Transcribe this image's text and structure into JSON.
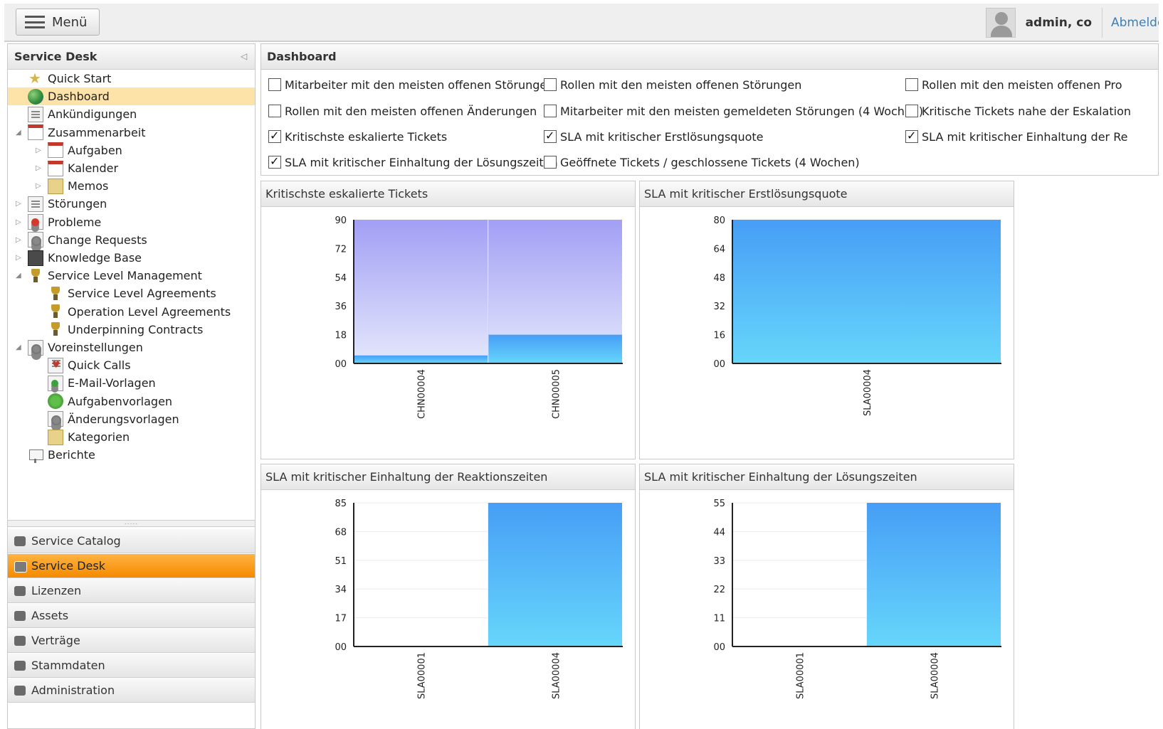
{
  "topbar": {
    "menu_label": "Menü",
    "username": "admin, co",
    "logout_label": "Abmelden"
  },
  "left_panel": {
    "title": "Service Desk",
    "tree": [
      {
        "label": "Quick Start",
        "icon": "star-icon",
        "level": 0,
        "expander": "none",
        "selected": false
      },
      {
        "label": "Dashboard",
        "icon": "globe-icon",
        "level": 0,
        "expander": "none",
        "selected": true
      },
      {
        "label": "Ankündigungen",
        "icon": "announcement-icon",
        "level": 0,
        "expander": "none",
        "selected": false
      },
      {
        "label": "Zusammenarbeit",
        "icon": "collaboration-icon",
        "level": 0,
        "expander": "expanded",
        "selected": false
      },
      {
        "label": "Aufgaben",
        "icon": "tasks-icon",
        "level": 1,
        "expander": "collapsed",
        "selected": false
      },
      {
        "label": "Kalender",
        "icon": "calendar-icon",
        "level": 1,
        "expander": "collapsed",
        "selected": false
      },
      {
        "label": "Memos",
        "icon": "memo-icon",
        "level": 1,
        "expander": "collapsed",
        "selected": false
      },
      {
        "label": "Störungen",
        "icon": "incidents-icon",
        "level": 0,
        "expander": "collapsed",
        "selected": false
      },
      {
        "label": "Probleme",
        "icon": "problems-icon",
        "level": 0,
        "expander": "collapsed",
        "selected": false
      },
      {
        "label": "Change Requests",
        "icon": "change-requests-icon",
        "level": 0,
        "expander": "collapsed",
        "selected": false
      },
      {
        "label": "Knowledge Base",
        "icon": "knowledge-base-icon",
        "level": 0,
        "expander": "collapsed",
        "selected": false
      },
      {
        "label": "Service Level Management",
        "icon": "trophy-icon",
        "level": 0,
        "expander": "expanded",
        "selected": false
      },
      {
        "label": "Service Level Agreements",
        "icon": "trophy-icon",
        "level": 1,
        "expander": "none",
        "selected": false
      },
      {
        "label": "Operation Level Agreements",
        "icon": "trophy-icon",
        "level": 1,
        "expander": "none",
        "selected": false
      },
      {
        "label": "Underpinning Contracts",
        "icon": "trophy-icon",
        "level": 1,
        "expander": "none",
        "selected": false
      },
      {
        "label": "Voreinstellungen",
        "icon": "settings-icon",
        "level": 0,
        "expander": "expanded",
        "selected": false
      },
      {
        "label": "Quick Calls",
        "icon": "quick-calls-icon",
        "level": 1,
        "expander": "none",
        "selected": false
      },
      {
        "label": "E-Mail-Vorlagen",
        "icon": "mail-template-icon",
        "level": 1,
        "expander": "none",
        "selected": false
      },
      {
        "label": "Aufgabenvorlagen",
        "icon": "task-template-icon",
        "level": 1,
        "expander": "none",
        "selected": false
      },
      {
        "label": "Änderungsvorlagen",
        "icon": "change-template-icon",
        "level": 1,
        "expander": "none",
        "selected": false
      },
      {
        "label": "Kategorien",
        "icon": "categories-icon",
        "level": 1,
        "expander": "none",
        "selected": false
      },
      {
        "label": "Berichte",
        "icon": "reports-icon",
        "level": 0,
        "expander": "none",
        "selected": false
      }
    ],
    "nav_buttons": [
      {
        "label": "Service Catalog",
        "icon": "service-catalog-icon",
        "active": false
      },
      {
        "label": "Service Desk",
        "icon": "service-desk-icon",
        "active": true
      },
      {
        "label": "Lizenzen",
        "icon": "licenses-icon",
        "active": false
      },
      {
        "label": "Assets",
        "icon": "assets-icon",
        "active": false
      },
      {
        "label": "Verträge",
        "icon": "contracts-icon",
        "active": false
      },
      {
        "label": "Stammdaten",
        "icon": "master-data-icon",
        "active": false
      },
      {
        "label": "Administration",
        "icon": "administration-icon",
        "active": false
      }
    ]
  },
  "dashboard": {
    "title": "Dashboard",
    "checkboxes": [
      {
        "label": "Mitarbeiter mit den meisten offenen Störungen",
        "checked": false
      },
      {
        "label": "Rollen mit den meisten offenen Störungen",
        "checked": false
      },
      {
        "label": "Rollen mit den meisten offenen Pro",
        "checked": false
      },
      {
        "label": "Rollen mit den meisten offenen Änderungen",
        "checked": false
      },
      {
        "label": "Mitarbeiter mit den meisten gemeldeten Störungen (4 Wochen)",
        "checked": false
      },
      {
        "label": "Kritische Tickets nahe der Eskalation",
        "checked": false
      },
      {
        "label": "Kritischste eskalierte Tickets",
        "checked": true
      },
      {
        "label": "SLA mit kritischer Erstlösungsquote",
        "checked": true
      },
      {
        "label": "SLA mit kritischer Einhaltung der Re",
        "checked": true
      },
      {
        "label": "SLA mit kritischer Einhaltung der Lösungszeiten",
        "checked": true
      },
      {
        "label": "Geöffnete Tickets / geschlossene Tickets (4 Wochen)",
        "checked": false
      }
    ]
  },
  "chart_data": [
    {
      "type": "bar",
      "title": "Kritischste eskalierte Tickets",
      "categories": [
        "CHN00004",
        "CHN00005"
      ],
      "series": [
        {
          "values": [
            5,
            18
          ],
          "color": "#4ab0f5"
        },
        {
          "values": [
            90,
            90
          ],
          "color": "#a9a5f5"
        }
      ],
      "yticks": [
        "00",
        "18",
        "36",
        "54",
        "72",
        "90"
      ],
      "ylim": [
        0,
        90
      ],
      "xlabel": "",
      "ylabel": ""
    },
    {
      "type": "bar",
      "title": "SLA mit kritischer Erstlösungsquote",
      "categories": [
        "SLA00004"
      ],
      "series": [
        {
          "values": [
            80
          ],
          "color": "#4aa8f8"
        }
      ],
      "yticks": [
        "00",
        "16",
        "32",
        "48",
        "64",
        "80"
      ],
      "ylim": [
        0,
        80
      ],
      "xlabel": "",
      "ylabel": ""
    },
    {
      "type": "bar",
      "title": "SLA mit kritischer Einhaltung der Reaktionszeiten",
      "categories": [
        "SLA00001",
        "SLA00004"
      ],
      "series": [
        {
          "values": [
            0,
            85
          ],
          "color": "#4aa8f8"
        }
      ],
      "yticks": [
        "00",
        "17",
        "34",
        "51",
        "68",
        "85"
      ],
      "ylim": [
        0,
        85
      ],
      "xlabel": "",
      "ylabel": ""
    },
    {
      "type": "bar",
      "title": "SLA mit kritischer Einhaltung der Lösungszeiten",
      "categories": [
        "SLA00001",
        "SLA00004"
      ],
      "series": [
        {
          "values": [
            0,
            55
          ],
          "color": "#4aa8f8"
        }
      ],
      "yticks": [
        "00",
        "11",
        "22",
        "33",
        "44",
        "55"
      ],
      "ylim": [
        0,
        55
      ],
      "xlabel": "",
      "ylabel": ""
    }
  ]
}
